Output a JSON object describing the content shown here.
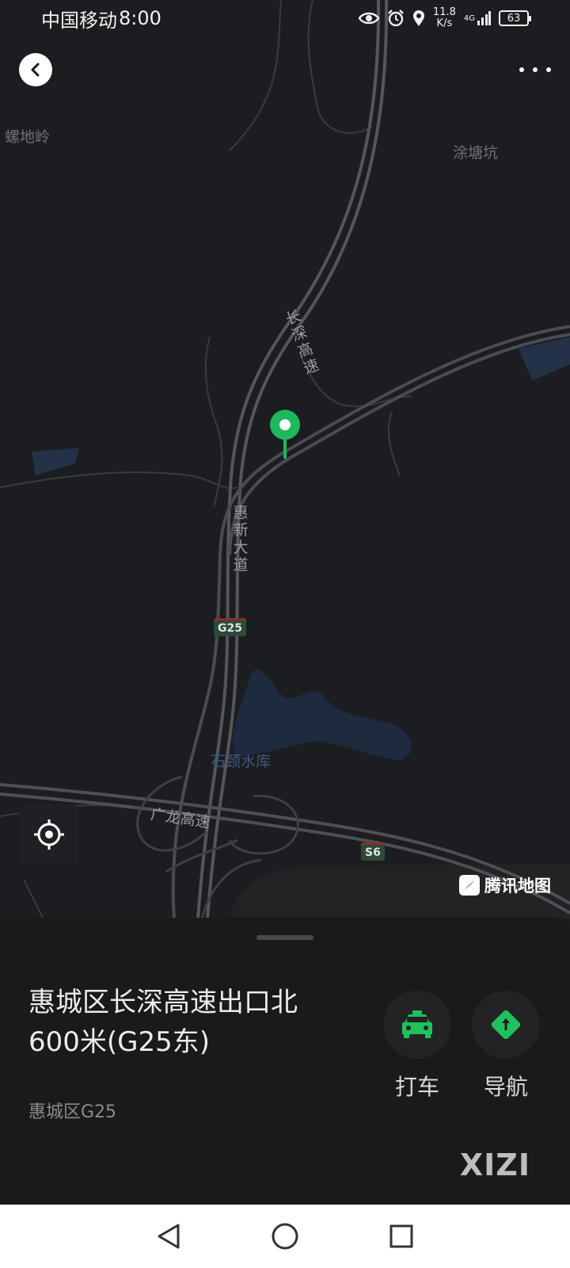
{
  "status_bar": {
    "carrier": "中国移动",
    "time": "8:00",
    "net_speed_value": "11.8",
    "net_speed_unit": "K/s",
    "network": "4G",
    "battery": "63",
    "icons": [
      "eye-icon",
      "alarm-icon",
      "location-icon",
      "signal-icon",
      "battery-icon"
    ]
  },
  "map": {
    "labels": {
      "luodiling": "螺地岭",
      "tutangkeng": "涂塘坑",
      "changshen_road": [
        "长",
        "深",
        "高",
        "速"
      ],
      "huixin_road": [
        "惠",
        "新",
        "大",
        "道"
      ],
      "reservoir": "石颈水库",
      "guanglong": "广龙高速"
    },
    "shields": {
      "g25": "G25",
      "s6": "S6"
    },
    "brand": "腾讯地图",
    "pin_color": "#1fb85c"
  },
  "sheet": {
    "title_line1": "惠城区长深高速出口北",
    "title_line2": "600米(G25东)",
    "subtitle": "惠城区G25",
    "actions": {
      "taxi": {
        "label": "打车",
        "icon": "taxi-icon",
        "color": "#1fc05e"
      },
      "navigate": {
        "label": "导航",
        "icon": "navigation-icon",
        "color": "#1fc05e"
      }
    },
    "watermark": "XIZI"
  },
  "nav_bar": {
    "back": "back-triangle-icon",
    "home": "home-circle-icon",
    "recents": "recents-square-icon"
  }
}
